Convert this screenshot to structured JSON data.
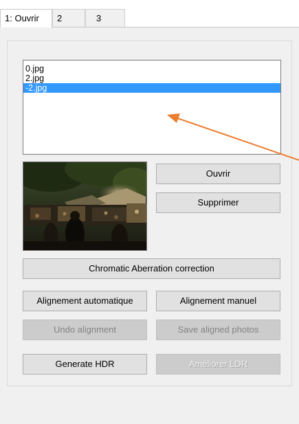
{
  "tabs": [
    {
      "label": "1: Ouvrir",
      "active": true
    },
    {
      "label": "2",
      "active": false
    },
    {
      "label": "3",
      "active": false
    }
  ],
  "file_list": {
    "items": [
      "0.jpg",
      "2.jpg",
      "-2.jpg"
    ],
    "selected_index": 2
  },
  "buttons": {
    "ouvrir": "Ouvrir",
    "supprimer": "Supprimer",
    "chromatic": "Chromatic Aberration correction",
    "alignement_auto": "Alignement automatique",
    "alignement_manuel": "Alignement manuel",
    "undo_alignment": "Undo alignment",
    "save_aligned": "Save aligned photos",
    "generate_hdr": "Generate HDR",
    "ameliorer_ldr": "Améliorer LDR"
  },
  "colors": {
    "selection": "#3399ff",
    "annotation_arrow": "#ed7d31",
    "panel_bg": "#f0f0f0",
    "button_bg": "#e1e1e1",
    "button_disabled_bg": "#cccccc"
  },
  "preview": {
    "icon": "photo-thumbnail"
  }
}
